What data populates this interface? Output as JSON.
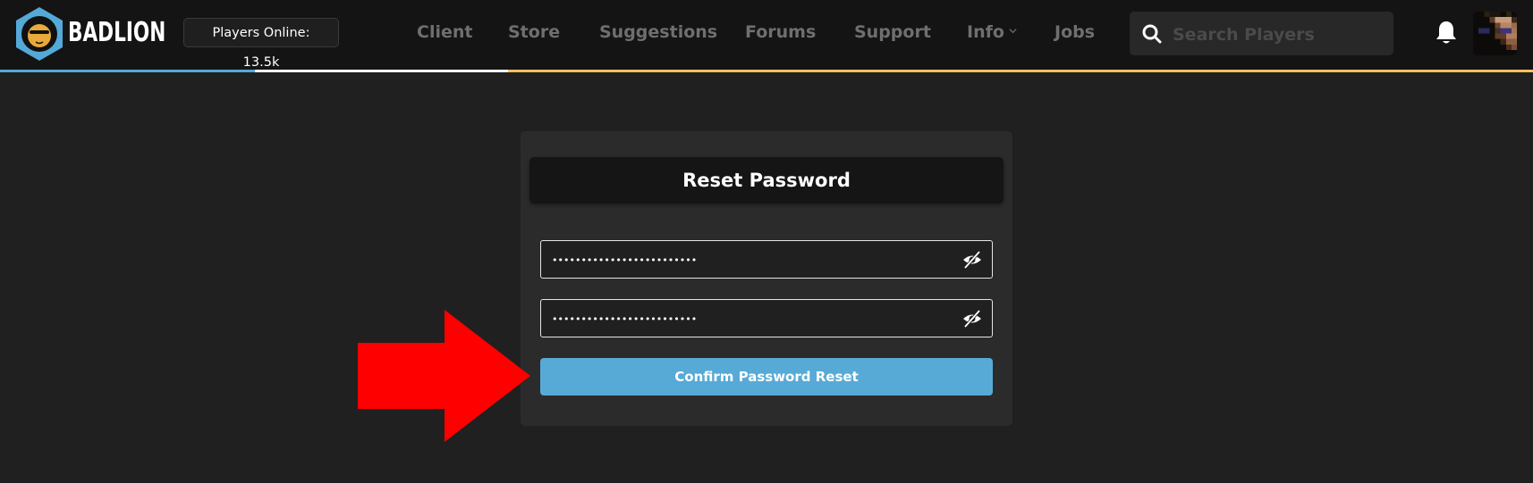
{
  "header": {
    "brand": "BADLION",
    "logo_icon": "badlion-lion-hexagon-logo",
    "players_online_label": "Players Online: 13.5k",
    "nav": [
      {
        "label": "Client"
      },
      {
        "label": "Store"
      },
      {
        "label": "Suggestions"
      },
      {
        "label": "Forums"
      },
      {
        "label": "Support"
      },
      {
        "label": "Info",
        "has_dropdown": true
      },
      {
        "label": "Jobs"
      }
    ],
    "search": {
      "placeholder": "Search Players",
      "value": "",
      "icon": "search-icon"
    },
    "notifications_icon": "bell-icon",
    "avatar_icon": "user-avatar"
  },
  "accent_colors": {
    "stripe_blue": "#54a9d8",
    "stripe_white": "#ffffff",
    "stripe_yellow": "#f6c25a",
    "button_blue": "#58aad6",
    "annotation_arrow": "#ff0000"
  },
  "form": {
    "title": "Reset Password",
    "new_password": {
      "value": "•••••••••••••••••••••••••",
      "toggle_icon": "eye-slash-icon"
    },
    "confirm_password": {
      "value": "•••••••••••••••••••••••••",
      "toggle_icon": "eye-slash-icon"
    },
    "submit_label": "Confirm Password Reset"
  },
  "annotation": {
    "type": "red-arrow",
    "points_to": "Confirm Password Reset"
  }
}
